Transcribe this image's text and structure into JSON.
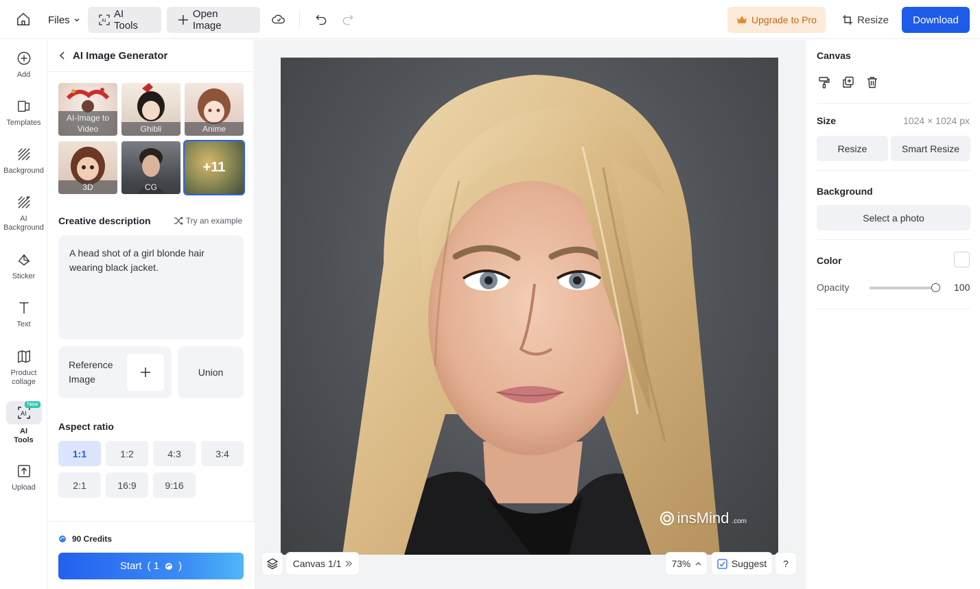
{
  "topbar": {
    "files_label": "Files",
    "ai_tools_label": "AI Tools",
    "open_image_label": "Open Image",
    "upgrade_label": "Upgrade to Pro",
    "resize_label": "Resize",
    "download_label": "Download",
    "colors": {
      "download_bg": "#1d5be8",
      "upgrade_bg": "#fcebd8",
      "upgrade_text": "#c8641a"
    }
  },
  "rail": {
    "items": [
      {
        "label": "Add",
        "icon": "plus-circle-icon"
      },
      {
        "label": "Templates",
        "icon": "templates-icon"
      },
      {
        "label": "Background",
        "icon": "background-icon"
      },
      {
        "label": "AI Background",
        "icon": "ai-background-icon"
      },
      {
        "label": "Sticker",
        "icon": "sticker-icon"
      },
      {
        "label": "Text",
        "icon": "text-icon"
      },
      {
        "label": "Product collage",
        "icon": "collage-icon"
      },
      {
        "label": "AI Tools",
        "icon": "ai-tools-icon",
        "active": true,
        "badge": "New"
      },
      {
        "label": "Upload",
        "icon": "upload-icon"
      }
    ]
  },
  "panel": {
    "title": "AI Image Generator",
    "styles": [
      {
        "label": "AI-Image to Video",
        "colors": [
          "#f5ece6",
          "#c9312b"
        ]
      },
      {
        "label": "Ghibli",
        "colors": [
          "#f0e6dc",
          "#2b2320"
        ]
      },
      {
        "label": "Anime",
        "colors": [
          "#efe2dc",
          "#9a5a3c"
        ]
      },
      {
        "label": "3D",
        "colors": [
          "#e9d8cc",
          "#6e3a24"
        ]
      },
      {
        "label": "CG",
        "colors": [
          "#8a8e94",
          "#2a2c30"
        ]
      },
      {
        "label": "+11",
        "colors": [
          "#c9b36a",
          "#4d5a3c"
        ],
        "selected": true
      }
    ],
    "description_title": "Creative description",
    "try_example": "Try an example",
    "description_text": "A head shot of a girl blonde hair wearing black jacket.",
    "reference_label": "Reference Image",
    "union_label": "Union",
    "aspect_title": "Aspect ratio",
    "ratios": [
      "1:1",
      "1:2",
      "4:3",
      "3:4",
      "2:1",
      "16:9",
      "9:16"
    ],
    "active_ratio": "1:1",
    "credits": "90 Credits",
    "start_label": "Start",
    "start_cost": "( 1",
    "start_cost_end": ")"
  },
  "canvas": {
    "watermark": "insMind",
    "watermark_suffix": ".com",
    "page_label": "Canvas 1/1",
    "zoom": "73%",
    "suggest_label": "Suggest",
    "help_label": "?"
  },
  "props": {
    "title": "Canvas",
    "size_title": "Size",
    "size_value": "1024 × 1024 px",
    "resize_label": "Resize",
    "smart_resize_label": "Smart Resize",
    "background_title": "Background",
    "select_photo_label": "Select a photo",
    "color_title": "Color",
    "opacity_label": "Opacity",
    "opacity_value": "100"
  }
}
